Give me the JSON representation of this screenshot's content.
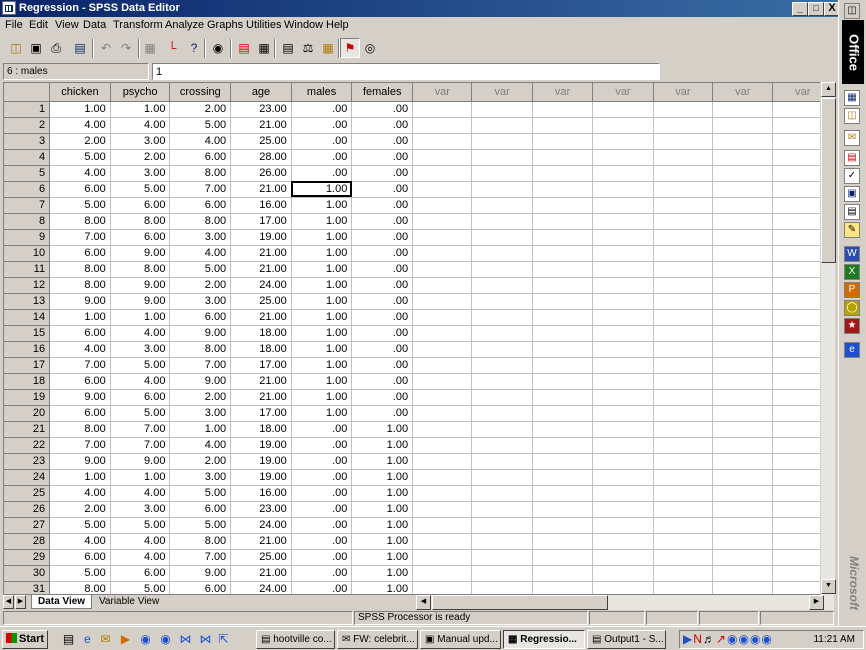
{
  "window": {
    "title": "Regression - SPSS Data Editor",
    "controls": [
      "_",
      "□",
      "X"
    ]
  },
  "menu": [
    "File",
    "Edit",
    "View",
    "Data",
    "Transform",
    "Analyze",
    "Graphs",
    "Utilities",
    "Window",
    "Help"
  ],
  "toolbar": {
    "icons": [
      "open-icon",
      "save-icon",
      "print-icon",
      "dialog-recall-icon",
      "undo-icon",
      "redo-icon",
      "goto-case-icon",
      "variables-icon",
      "find-icon",
      "insert-case-icon",
      "insert-variable-icon",
      "split-file-icon",
      "weight-cases-icon",
      "select-cases-icon",
      "value-labels-icon",
      "use-sets-icon"
    ]
  },
  "cell_editor": {
    "reference": "6 : males",
    "value": "1"
  },
  "grid": {
    "columns": [
      "chicken",
      "psycho",
      "crossing",
      "age",
      "males",
      "females",
      "var",
      "var",
      "var",
      "var",
      "var",
      "var",
      "var"
    ],
    "active_row": 6,
    "active_col": 4,
    "rows": [
      [
        "1.00",
        "1.00",
        "2.00",
        "23.00",
        ".00",
        ".00"
      ],
      [
        "4.00",
        "4.00",
        "5.00",
        "21.00",
        ".00",
        ".00"
      ],
      [
        "2.00",
        "3.00",
        "4.00",
        "25.00",
        ".00",
        ".00"
      ],
      [
        "5.00",
        "2.00",
        "6.00",
        "28.00",
        ".00",
        ".00"
      ],
      [
        "4.00",
        "3.00",
        "8.00",
        "26.00",
        ".00",
        ".00"
      ],
      [
        "6.00",
        "5.00",
        "7.00",
        "21.00",
        "1.00",
        ".00"
      ],
      [
        "5.00",
        "6.00",
        "6.00",
        "16.00",
        "1.00",
        ".00"
      ],
      [
        "8.00",
        "8.00",
        "8.00",
        "17.00",
        "1.00",
        ".00"
      ],
      [
        "7.00",
        "6.00",
        "3.00",
        "19.00",
        "1.00",
        ".00"
      ],
      [
        "6.00",
        "9.00",
        "4.00",
        "21.00",
        "1.00",
        ".00"
      ],
      [
        "8.00",
        "8.00",
        "5.00",
        "21.00",
        "1.00",
        ".00"
      ],
      [
        "8.00",
        "9.00",
        "2.00",
        "24.00",
        "1.00",
        ".00"
      ],
      [
        "9.00",
        "9.00",
        "3.00",
        "25.00",
        "1.00",
        ".00"
      ],
      [
        "1.00",
        "1.00",
        "6.00",
        "21.00",
        "1.00",
        ".00"
      ],
      [
        "6.00",
        "4.00",
        "9.00",
        "18.00",
        "1.00",
        ".00"
      ],
      [
        "4.00",
        "3.00",
        "8.00",
        "18.00",
        "1.00",
        ".00"
      ],
      [
        "7.00",
        "5.00",
        "7.00",
        "17.00",
        "1.00",
        ".00"
      ],
      [
        "6.00",
        "4.00",
        "9.00",
        "21.00",
        "1.00",
        ".00"
      ],
      [
        "9.00",
        "6.00",
        "2.00",
        "21.00",
        "1.00",
        ".00"
      ],
      [
        "6.00",
        "5.00",
        "3.00",
        "17.00",
        "1.00",
        ".00"
      ],
      [
        "8.00",
        "7.00",
        "1.00",
        "18.00",
        ".00",
        "1.00"
      ],
      [
        "7.00",
        "7.00",
        "4.00",
        "19.00",
        ".00",
        "1.00"
      ],
      [
        "9.00",
        "9.00",
        "2.00",
        "19.00",
        ".00",
        "1.00"
      ],
      [
        "1.00",
        "1.00",
        "3.00",
        "19.00",
        ".00",
        "1.00"
      ],
      [
        "4.00",
        "4.00",
        "5.00",
        "16.00",
        ".00",
        "1.00"
      ],
      [
        "2.00",
        "3.00",
        "6.00",
        "23.00",
        ".00",
        "1.00"
      ],
      [
        "5.00",
        "5.00",
        "5.00",
        "24.00",
        ".00",
        "1.00"
      ],
      [
        "4.00",
        "4.00",
        "8.00",
        "21.00",
        ".00",
        "1.00"
      ],
      [
        "6.00",
        "4.00",
        "7.00",
        "25.00",
        ".00",
        "1.00"
      ],
      [
        "5.00",
        "6.00",
        "9.00",
        "21.00",
        ".00",
        "1.00"
      ],
      [
        "8.00",
        "5.00",
        "6.00",
        "24.00",
        ".00",
        "1.00"
      ]
    ]
  },
  "tabs": {
    "data_view": "Data View",
    "variable_view": "Variable View"
  },
  "status": {
    "processor": "SPSS Processor  is ready"
  },
  "taskbar": {
    "start": "Start",
    "tasks": [
      "hootville co...",
      "FW: celebrit...",
      "Manual upd...",
      "Regressio...",
      "Output1 - S..."
    ],
    "active_task": 3,
    "clock": "11:21 AM"
  },
  "office_bar": {
    "label": "Office",
    "brand": "Microsoft"
  }
}
